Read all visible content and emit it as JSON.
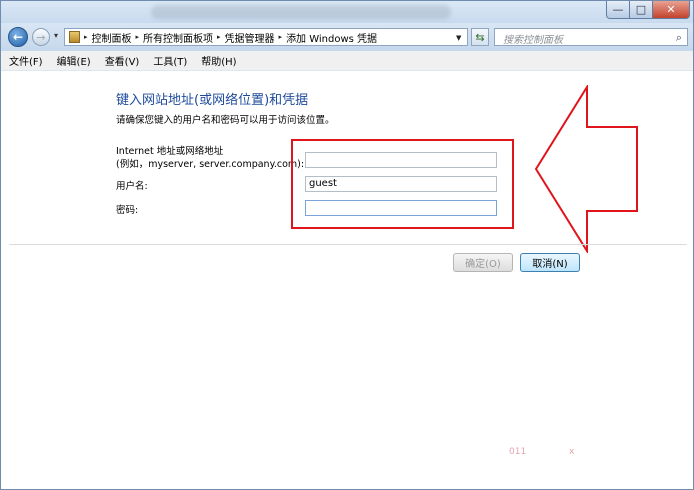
{
  "window": {
    "minimize_glyph": "—",
    "maximize_glyph": "□",
    "close_glyph": "✕"
  },
  "address": {
    "breadcrumbs": [
      "控制面板",
      "所有控制面板项",
      "凭据管理器",
      "添加 Windows 凭据"
    ],
    "separator": "▸"
  },
  "search": {
    "placeholder": "搜索控制面板"
  },
  "menu": {
    "items": [
      "文件(F)",
      "编辑(E)",
      "查看(V)",
      "工具(T)",
      "帮助(H)"
    ]
  },
  "form": {
    "heading": "键入网站地址(或网络位置)和凭据",
    "intro": "请确保您键入的用户名和密码可以用于访问该位置。",
    "address_label_1": "Internet 地址或网络地址",
    "address_label_2": "(例如，myserver, server.company.com):",
    "address_value": "",
    "username_label": "用户名:",
    "username_value": "guest",
    "password_label": "密码:",
    "password_value": ""
  },
  "buttons": {
    "ok": "确定(O)",
    "cancel": "取消(N)"
  },
  "watermark": {
    "left": "011",
    "right": "x"
  },
  "colors": {
    "heading": "#1e4a9b",
    "highlight_red": "#e0151b",
    "titlebar": "#dbe8f6"
  }
}
